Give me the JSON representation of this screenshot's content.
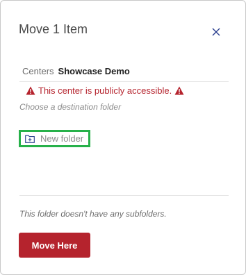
{
  "dialog": {
    "title": "Move 1 Item",
    "close_icon": "close-icon"
  },
  "breadcrumb": {
    "items": [
      {
        "label": "Centers"
      },
      {
        "label": "Showcase Demo"
      }
    ]
  },
  "warning": {
    "text": "This center is publicly accessible.",
    "icon": "warning-triangle-icon",
    "color": "#b5232d"
  },
  "hint": "Choose a destination folder",
  "new_folder": {
    "label": "New folder",
    "icon": "folder-plus-icon",
    "highlight_color": "#27b14a"
  },
  "empty_note": "This folder doesn't have any subfolders.",
  "actions": {
    "move_label": "Move Here",
    "move_color": "#b5232d"
  }
}
